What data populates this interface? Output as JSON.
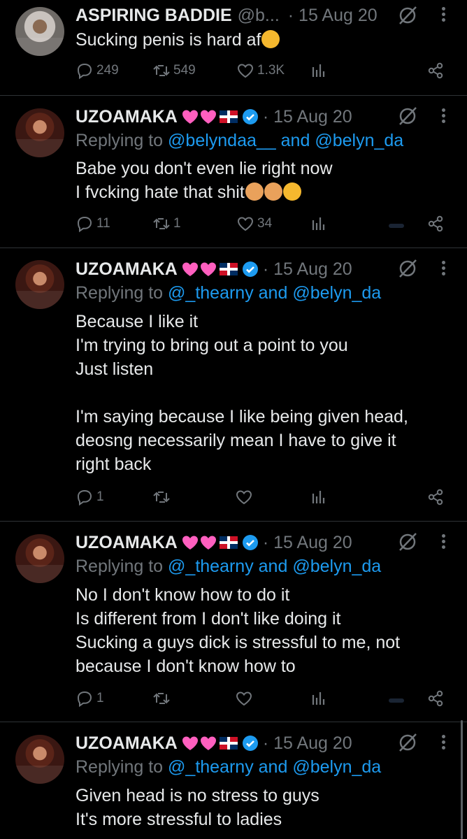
{
  "tweets": [
    {
      "name": "ASPIRING BADDIE",
      "handle": "@b...",
      "date": "· 15 Aug 20",
      "reply_label": "",
      "lines": [
        "Sucking penis is hard af"
      ],
      "replies": "249",
      "reposts": "549",
      "likes": "1.3K"
    },
    {
      "name": "UZOAMAKA",
      "date": "· 15 Aug 20",
      "reply_label": "Replying to",
      "mention_1": "@belyndaa__",
      "and": "and",
      "mention_2": "@belyn_da",
      "lines": [
        "Babe you don't even lie right now",
        "I fvcking hate that shit"
      ],
      "replies": "11",
      "reposts": "1",
      "likes": "34"
    },
    {
      "name": "UZOAMAKA",
      "date": "· 15 Aug 20",
      "reply_label": "Replying to",
      "mention_1": "@_thearny",
      "and": "and",
      "mention_2": "@belyn_da",
      "lines": [
        "Because I like it",
        "I'm trying to bring out a point to you",
        "Just listen",
        "",
        "I'm saying because I like being given head,",
        "deosng necessarily mean I have to give it",
        "right back"
      ],
      "replies": "1",
      "reposts": "",
      "likes": ""
    },
    {
      "name": "UZOAMAKA",
      "date": "· 15 Aug 20",
      "reply_label": "Replying to",
      "mention_1": "@_thearny",
      "and": "and",
      "mention_2": "@belyn_da",
      "lines": [
        "No I don't know how to do it",
        "Is different from I don't like doing it",
        "Sucking a guys dick is stressful to me, not",
        "because I don't know how to"
      ],
      "replies": "1",
      "reposts": "",
      "likes": ""
    },
    {
      "name": "UZOAMAKA",
      "date": "· 15 Aug 20",
      "reply_label": "Replying to",
      "mention_1": "@_thearny",
      "and": "and",
      "mention_2": "@belyn_da",
      "lines": [
        "Given head is no stress to guys",
        "It's more stressful to ladies"
      ]
    }
  ],
  "colors": {
    "background": "#000000",
    "text": "#e7e9ea",
    "muted": "#71767b",
    "link": "#1d9bf0",
    "verified": "#1d9bf0",
    "heart_emoji": "#ff5fbf",
    "divider": "#2f3336"
  },
  "icons": [
    "reply-icon",
    "repost-icon",
    "like-icon",
    "views-icon",
    "share-icon",
    "grok-icon",
    "more-icon",
    "verified-icon",
    "heart-emoji-icon",
    "flag-emoji-icon"
  ]
}
